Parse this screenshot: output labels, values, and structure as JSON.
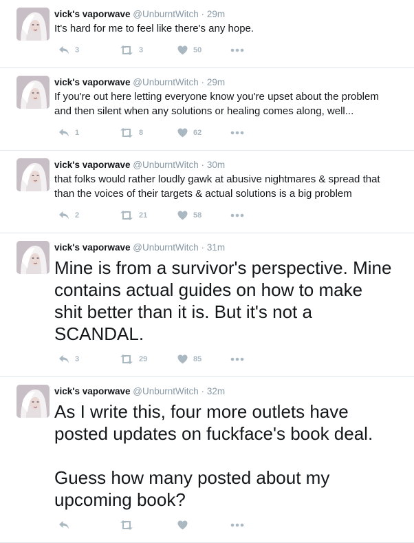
{
  "tweets": [
    {
      "name": "vick's vaporwave",
      "handle": "@UnburntWitch",
      "time": "29m",
      "text": "It's hard for me to feel like there's any hope.",
      "size": "small",
      "replies": "3",
      "retweets": "3",
      "likes": "50"
    },
    {
      "name": "vick's vaporwave",
      "handle": "@UnburntWitch",
      "time": "29m",
      "text": "If you're out here letting everyone know you're upset about the problem\nand then silent when any solutions or healing comes along, well...",
      "size": "small",
      "replies": "1",
      "retweets": "8",
      "likes": "62"
    },
    {
      "name": "vick's vaporwave",
      "handle": "@UnburntWitch",
      "time": "30m",
      "text": "that folks would rather loudly gawk at abusive nightmares & spread that\nthan the voices of their targets & actual solutions is a big problem",
      "size": "small",
      "replies": "2",
      "retweets": "21",
      "likes": "58"
    },
    {
      "name": "vick's vaporwave",
      "handle": "@UnburntWitch",
      "time": "31m",
      "text": "Mine is from a survivor's perspective. Mine\ncontains actual guides on how to make\nshit better than it is. But it's not a\nSCANDAL.",
      "size": "big",
      "replies": "3",
      "retweets": "29",
      "likes": "85"
    },
    {
      "name": "vick's vaporwave",
      "handle": "@UnburntWitch",
      "time": "32m",
      "text": "As I write this, four more outlets have\nposted updates on fuckface's book deal.\n\nGuess how many posted about my\nupcoming book?",
      "size": "big",
      "replies": "",
      "retweets": "",
      "likes": ""
    }
  ],
  "icons": {
    "reply": "reply-icon",
    "retweet": "retweet-icon",
    "like": "heart-icon",
    "more": "more-dots-icon",
    "avatar": "avatar"
  },
  "colors": {
    "name": "#14171a",
    "meta": "#8899a6",
    "action": "#aab8c2",
    "divider": "#e1e8ed"
  }
}
